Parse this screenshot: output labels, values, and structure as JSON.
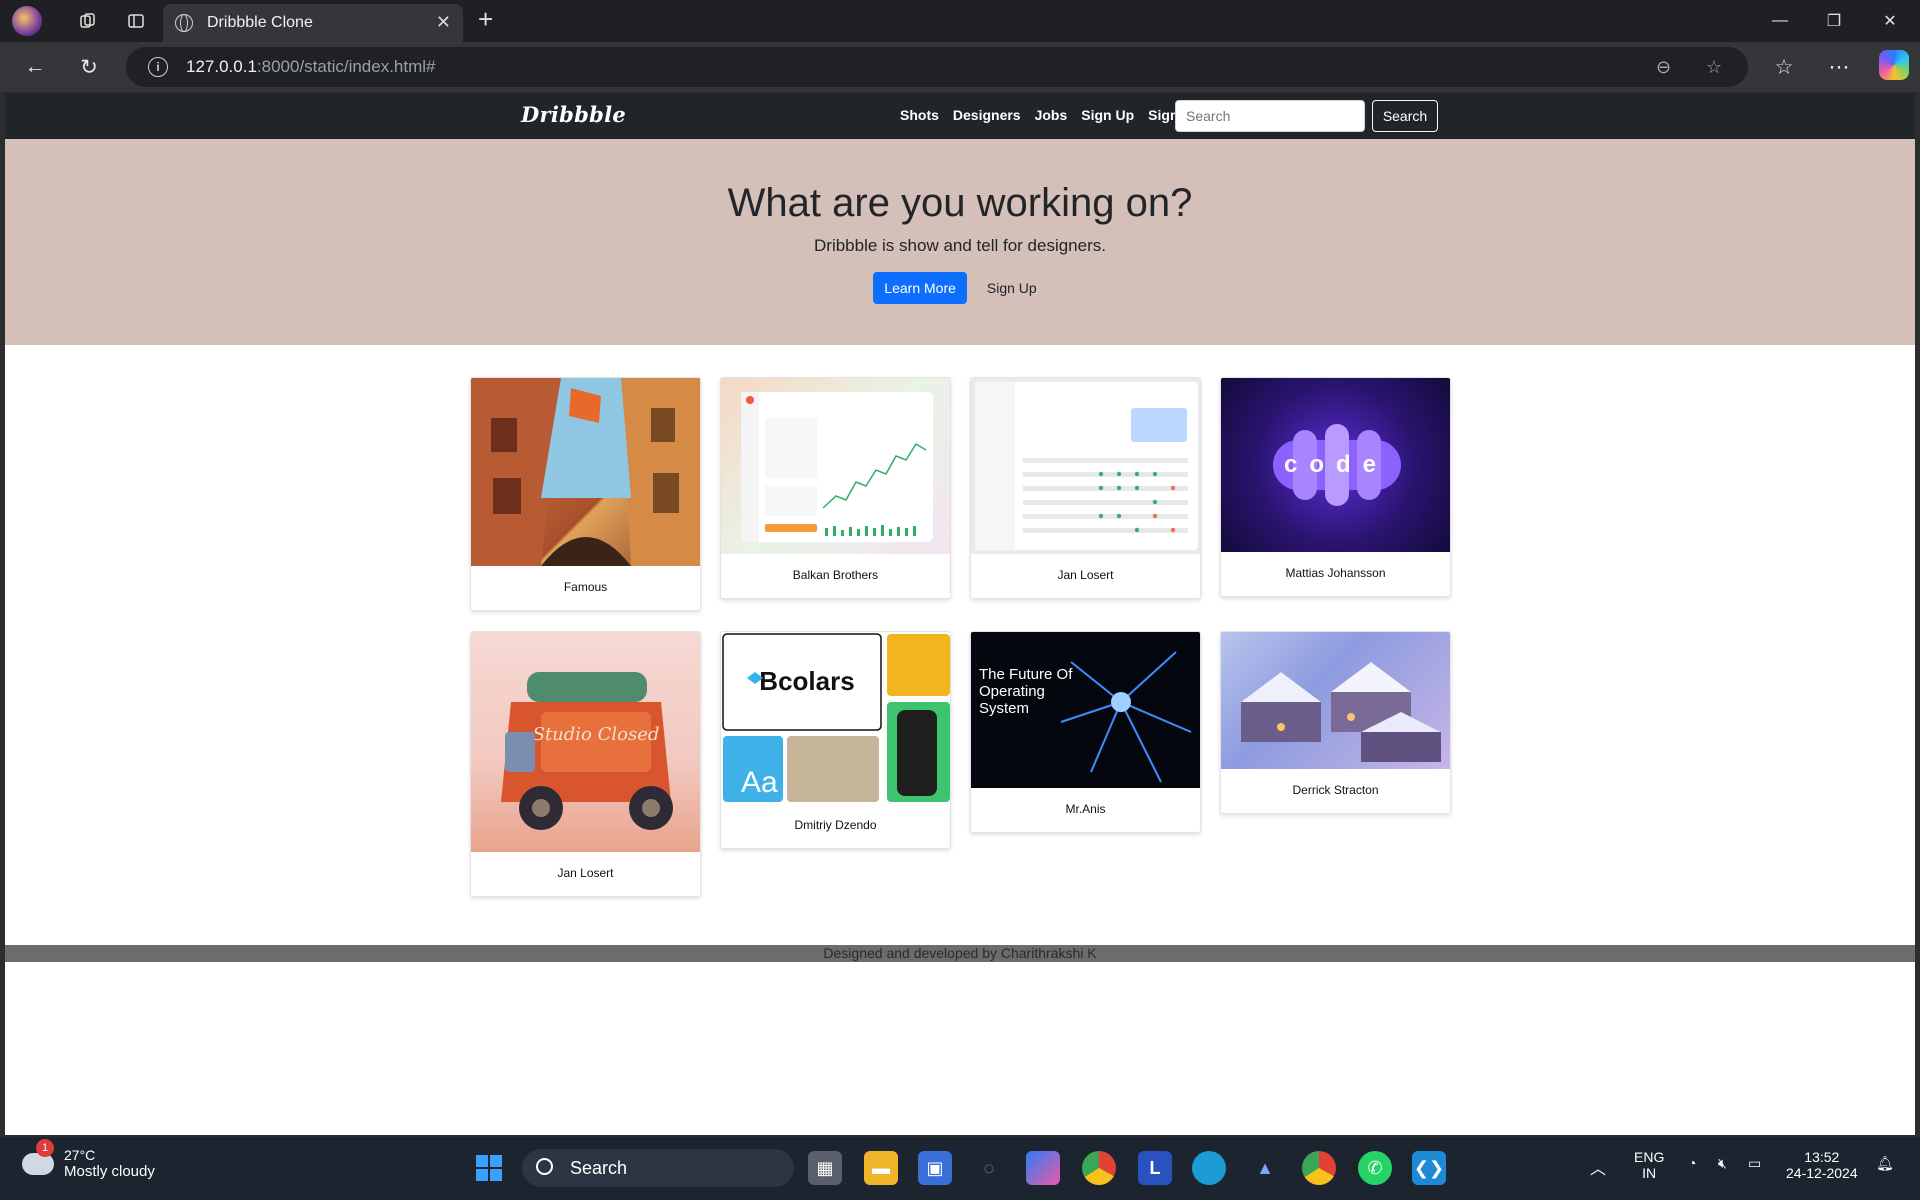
{
  "browser": {
    "tab_title": "Dribbble Clone",
    "url_host": "127.0.0.1",
    "url_rest": ":8000/static/index.html#"
  },
  "site": {
    "brand": "Dribbble",
    "nav": [
      "Shots",
      "Designers",
      "Jobs",
      "Sign Up",
      "Sign in"
    ],
    "search_placeholder": "Search",
    "search_button": "Search"
  },
  "hero": {
    "title": "What are you working on?",
    "subtitle": "Dribbble is show and tell for designers.",
    "primary_button": "Learn More",
    "secondary_button": "Sign Up"
  },
  "shots": [
    {
      "caption": "Famous",
      "icon": "illustration-street"
    },
    {
      "caption": "Balkan Brothers",
      "icon": "dashboard-chart"
    },
    {
      "caption": "Jan Losert",
      "icon": "dashboard-table"
    },
    {
      "caption": "Mattias Johansson",
      "icon": "code-logo",
      "logo_text": "code"
    },
    {
      "caption": "Jan Losert",
      "icon": "illustration-truck",
      "logo_text": "Studio Closed"
    },
    {
      "caption": "Dmitriy Dzendo",
      "icon": "brand-identity",
      "logo_text": "Bcolars"
    },
    {
      "caption": "Mr.Anis",
      "icon": "neuron-hero",
      "logo_text": "The Future Of Operating System"
    },
    {
      "caption": "Derrick Stracton",
      "icon": "illustration-village"
    }
  ],
  "footer": {
    "text": "Designed and developed by Charithrakshi K"
  },
  "taskbar": {
    "temperature": "27°C",
    "condition": "Mostly cloudy",
    "weather_badge": "1",
    "search": "Search",
    "lang_top": "ENG",
    "lang_bottom": "IN",
    "time": "13:52",
    "date": "24-12-2024"
  },
  "colors": {
    "hero_bg": "#d5bfb9",
    "navbar_bg": "#212529",
    "primary": "#0d6efd",
    "footer_bg": "#6c6c6c"
  }
}
